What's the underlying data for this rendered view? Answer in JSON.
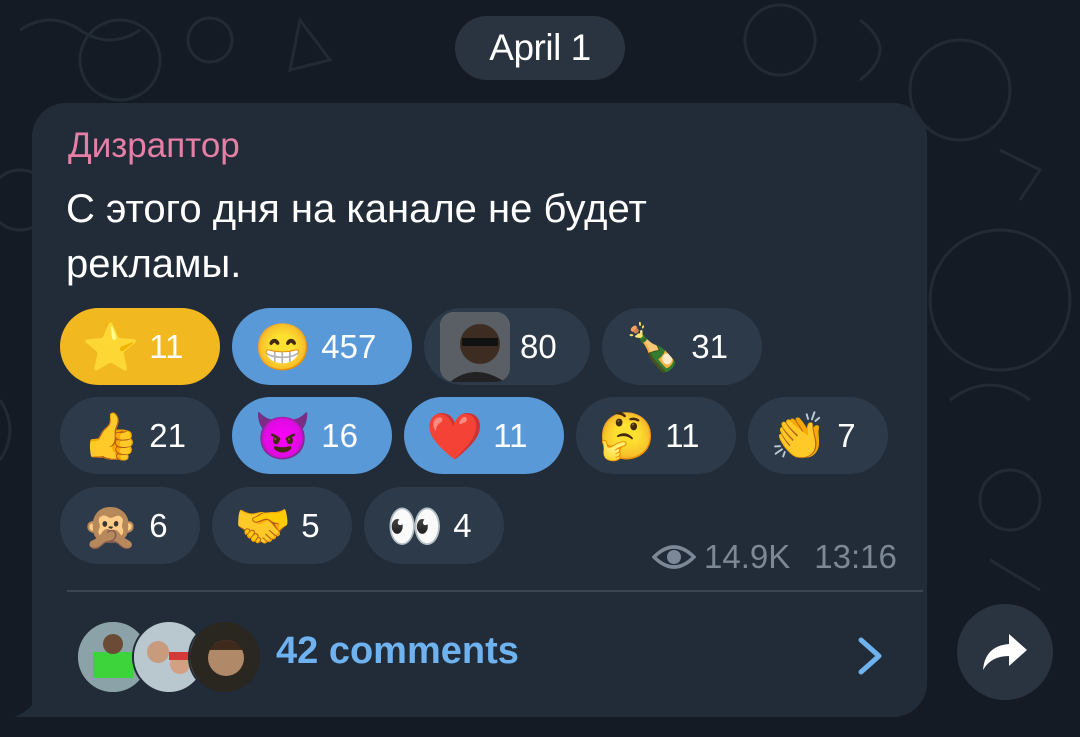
{
  "date": "April 1",
  "post": {
    "author": "Дизраптор",
    "text": "С этого дня на канале не будет рекламы."
  },
  "reactions": [
    {
      "emoji": "⭐",
      "count": "11",
      "style": "star"
    },
    {
      "emoji": "😁",
      "count": "457",
      "style": "chosen"
    },
    {
      "emoji": "custom-avatar-emoji",
      "count": "80",
      "style": "normal"
    },
    {
      "emoji": "🍾",
      "count": "31",
      "style": "normal"
    },
    {
      "emoji": "👍",
      "count": "21",
      "style": "normal"
    },
    {
      "emoji": "😈",
      "count": "16",
      "style": "chosen"
    },
    {
      "emoji": "❤️",
      "count": "11",
      "style": "chosen"
    },
    {
      "emoji": "🤔",
      "count": "11",
      "style": "normal"
    },
    {
      "emoji": "👏",
      "count": "7",
      "style": "normal"
    },
    {
      "emoji": "🙊",
      "count": "6",
      "style": "normal"
    },
    {
      "emoji": "🤝",
      "count": "5",
      "style": "normal"
    },
    {
      "emoji": "👀",
      "count": "4",
      "style": "normal"
    }
  ],
  "meta": {
    "views": "14.9K",
    "time": "13:16",
    "views_icon": "eye-icon"
  },
  "comments": {
    "label": "42 comments",
    "arrow_icon": "chevron-right-icon"
  },
  "share_icon": "share-arrow-icon",
  "colors": {
    "background": "#151b24",
    "bubble": "#222c38",
    "author": "#e77ea5",
    "chosen_reaction": "#5a99d8",
    "reaction": "#2d3a4a",
    "star_reaction": "#f2b820",
    "link": "#6eb3f0"
  }
}
